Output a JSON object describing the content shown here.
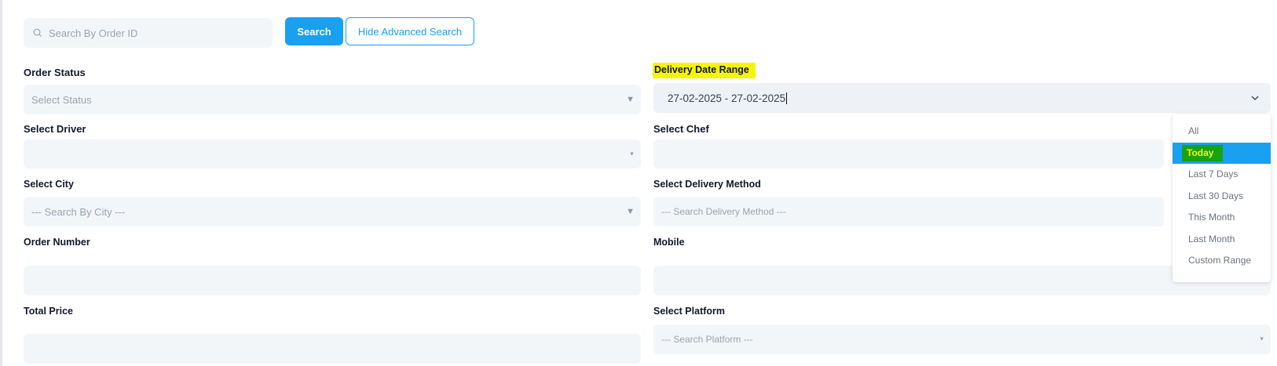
{
  "search": {
    "placeholder": "Search By Order ID",
    "search_button": "Search",
    "toggle_button": "Hide Advanced Search"
  },
  "filters": {
    "order_status": {
      "label": "Order Status",
      "placeholder": "Select Status"
    },
    "delivery_date_range": {
      "label": "Delivery Date Range",
      "value": "27-02-2025 - 27-02-2025"
    },
    "driver": {
      "label": "Select Driver",
      "value": ""
    },
    "chef": {
      "label": "Select Chef",
      "value": ""
    },
    "city": {
      "label": "Select City",
      "placeholder": "--- Search By City ---"
    },
    "delivery_method": {
      "label": "Select Delivery Method",
      "placeholder": "--- Search Delivery Method ---"
    },
    "order_number": {
      "label": "Order Number",
      "value": ""
    },
    "mobile": {
      "label": "Mobile",
      "value": ""
    },
    "total_price": {
      "label": "Total Price",
      "value": ""
    },
    "platform": {
      "label": "Select Platform",
      "placeholder": "--- Search Platform ---"
    }
  },
  "date_range_menu": {
    "items": [
      "All",
      "Today",
      "Last 7 Days",
      "Last 30 Days",
      "This Month",
      "Last Month",
      "Custom Range"
    ],
    "selected": "Today"
  },
  "colors": {
    "primary": "#1aa0f0",
    "field_bg": "#f3f6f9",
    "highlight_yellow": "#f5f50a",
    "highlight_green": "#16a316"
  },
  "icons": {
    "search": "search-icon",
    "select_caret": "triangle-down-icon",
    "date_chevron": "chevron-down-icon"
  }
}
